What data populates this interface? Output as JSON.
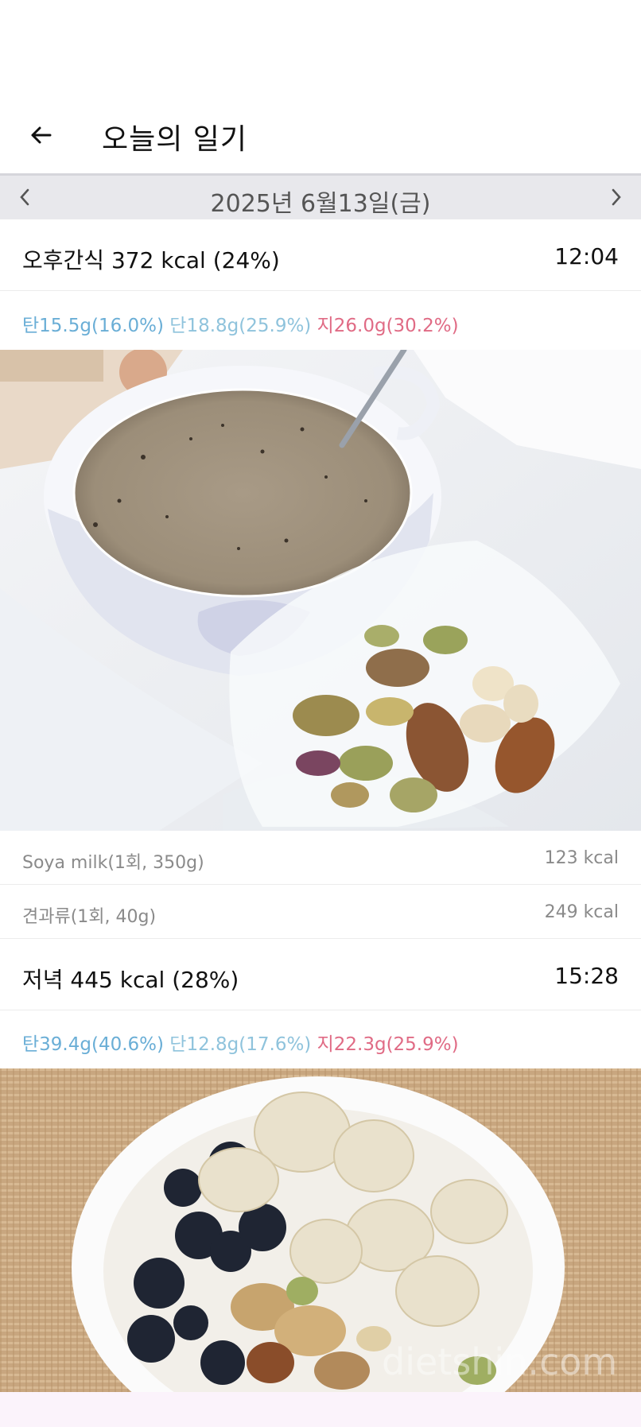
{
  "header": {
    "title": "오늘의 일기"
  },
  "date_bar": {
    "date": "2025년 6월13일(금)"
  },
  "meals": [
    {
      "name": "오후간식 372 kcal (24%)",
      "time": "12:04",
      "macros": {
        "carb": "탄15.5g(16.0%)",
        "protein": "단18.8g(25.9%)",
        "fat": "지26.0g(30.2%)"
      },
      "foods": [
        {
          "name": "Soya milk(1회, 350g)",
          "kcal": "123 kcal"
        },
        {
          "name": "견과류(1회, 40g)",
          "kcal": "249 kcal"
        }
      ]
    },
    {
      "name": "저녁 445 kcal (28%)",
      "time": "15:28",
      "macros": {
        "carb": "탄39.4g(40.6%)",
        "protein": "단12.8g(17.6%)",
        "fat": "지22.3g(25.9%)"
      }
    }
  ],
  "photo2_watermark": "dietshin.com",
  "colors": {
    "carb": "#6aaed6",
    "protein": "#8fc3dc",
    "fat": "#e06b85",
    "date_bar_bg": "#e8e8ec"
  }
}
